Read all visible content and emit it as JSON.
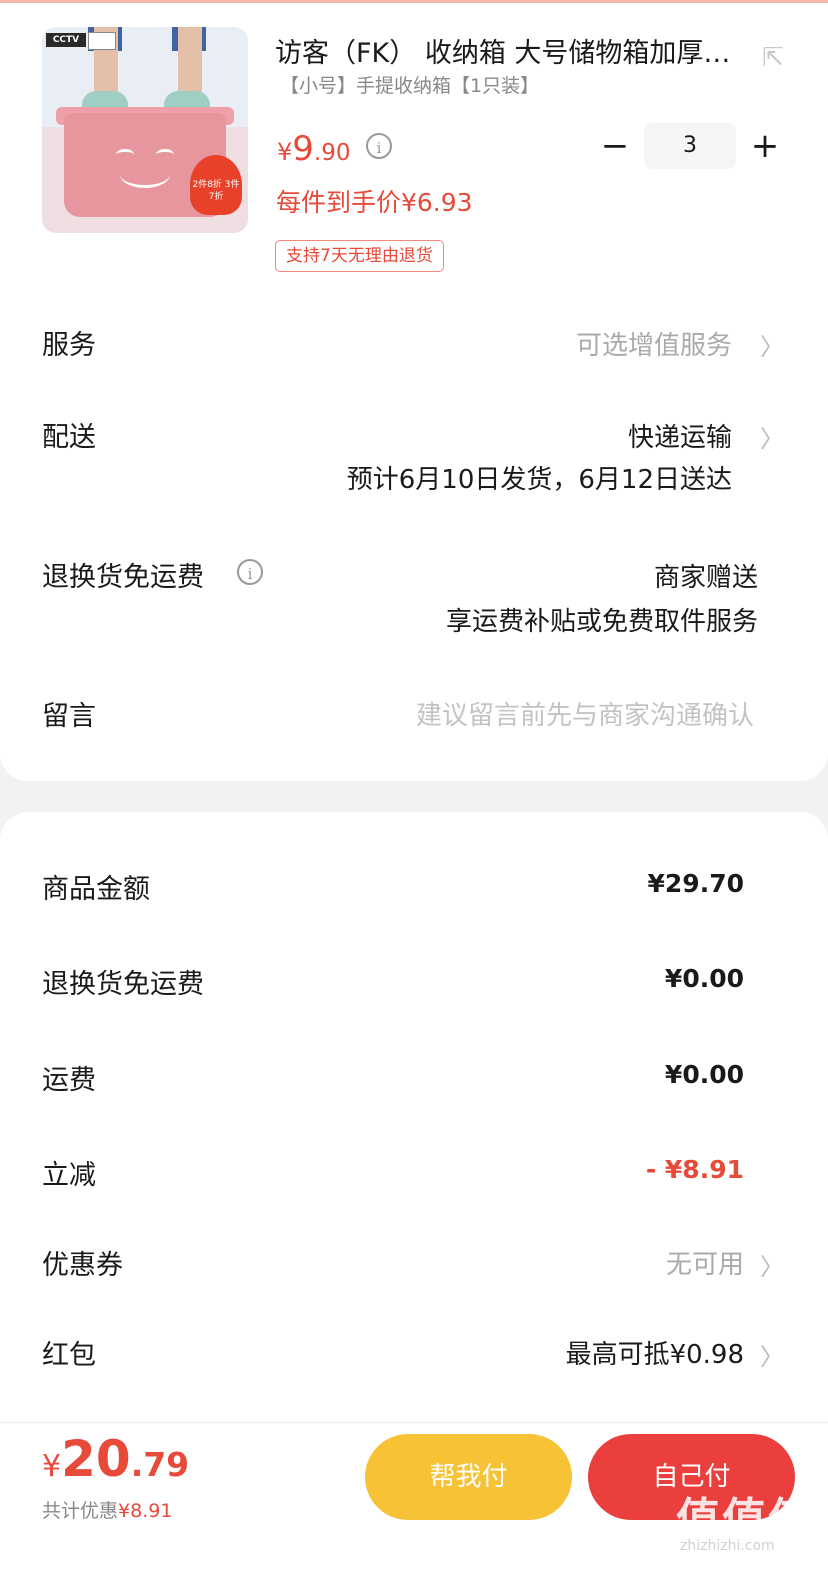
{
  "product": {
    "brand_badge": "CCTV",
    "promo_badge": "2件8折 3件7折",
    "title": "访客（FK） 收纳箱 大号储物箱加厚…",
    "sku": "【小号】手提收纳箱【1只装】",
    "price": {
      "currency": "¥",
      "integer": "9",
      "decimal": ".90"
    },
    "quantity": "3",
    "minus": "−",
    "plus": "+",
    "unit_price_label": "每件到手价¥6.93",
    "return_tag": "支持7天无理由退货",
    "share_icon": "share-icon",
    "info_icon": "i"
  },
  "options": {
    "service": {
      "label": "服务",
      "value": "可选增值服务"
    },
    "delivery": {
      "label": "配送",
      "value": "快递运输",
      "eta": "预计6月10日发货，6月12日送达"
    },
    "return_shipping": {
      "label": "退换货免运费",
      "value": "商家赠送",
      "detail": "享运费补贴或免费取件服务"
    },
    "message": {
      "label": "留言",
      "placeholder": "建议留言前先与商家沟通确认"
    }
  },
  "amounts": {
    "goods": {
      "label": "商品金额",
      "value": "¥29.70"
    },
    "return_fee": {
      "label": "退换货免运费",
      "value": "¥0.00"
    },
    "shipping": {
      "label": "运费",
      "value": "¥0.00"
    },
    "discount": {
      "label": "立减",
      "value": "- ¥8.91"
    },
    "coupon": {
      "label": "优惠券",
      "value": "无可用"
    },
    "red_packet": {
      "label": "红包",
      "value": "最高可抵¥0.98"
    }
  },
  "checkout": {
    "total": {
      "currency": "¥",
      "integer": "20",
      "decimal": ".79"
    },
    "saved_label": "共计优惠",
    "saved_value": "¥8.91",
    "help_pay": "帮我付",
    "self_pay": "自己付",
    "watermark": "值值值",
    "watermark_sub": "zhizhizhi.com"
  },
  "colors": {
    "accent": "#e84a3a",
    "yellow": "#f7c235",
    "red_button": "#ea3f3c"
  }
}
